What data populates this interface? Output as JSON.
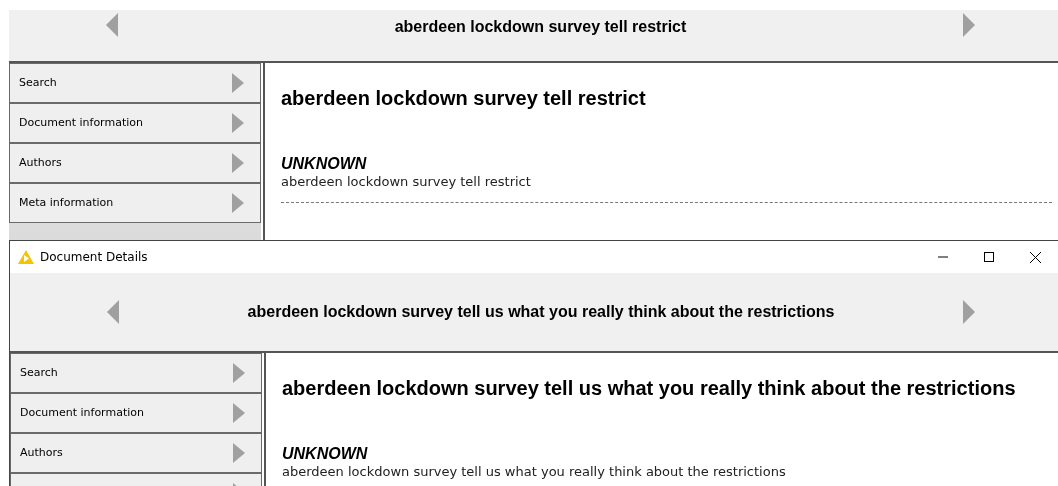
{
  "back_window": {
    "header_title": "aberdeen lockdown survey tell restrict",
    "sidebar_items": [
      {
        "label": "Search"
      },
      {
        "label": "Document information"
      },
      {
        "label": "Authors"
      },
      {
        "label": "Meta information"
      }
    ],
    "content": {
      "title": "aberdeen lockdown survey tell restrict",
      "author": "UNKNOWN",
      "text": "aberdeen lockdown survey tell restrict"
    }
  },
  "front_window": {
    "title": "Document Details",
    "header_title": "aberdeen lockdown survey tell us what you really think about the restrictions",
    "sidebar_items": [
      {
        "label": "Search"
      },
      {
        "label": "Document information"
      },
      {
        "label": "Authors"
      }
    ],
    "content": {
      "title": "aberdeen lockdown survey tell us what you really think about the restrictions",
      "author": "UNKNOWN",
      "text": "aberdeen lockdown survey tell us what you really think about the restrictions"
    }
  }
}
